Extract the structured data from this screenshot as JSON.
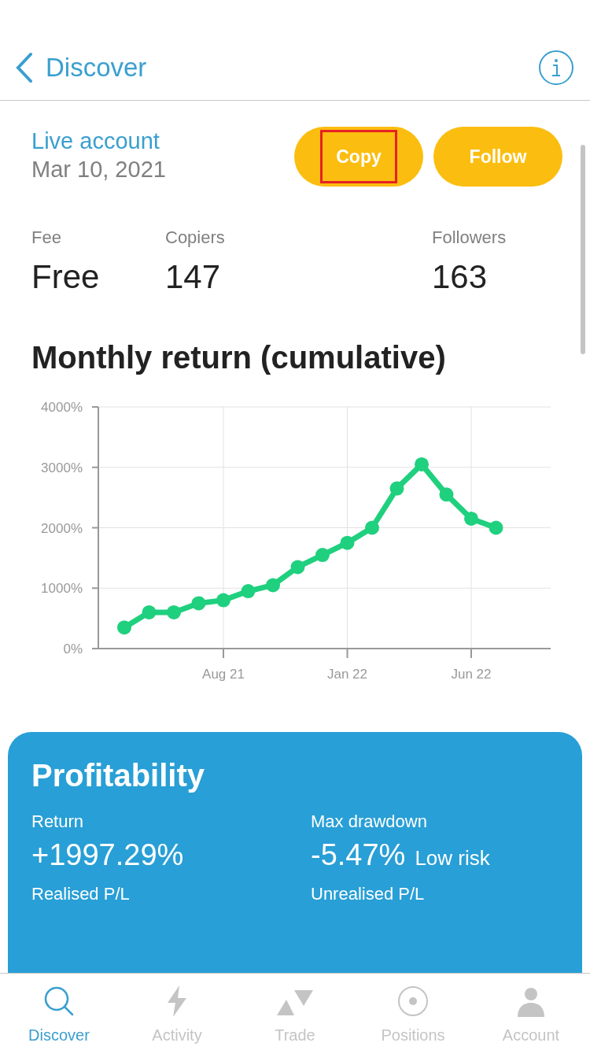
{
  "header": {
    "back_label": "Discover"
  },
  "account": {
    "type": "Live account",
    "date": "Mar 10, 2021"
  },
  "buttons": [
    {
      "label": "Copy",
      "highlighted": true
    },
    {
      "label": "Follow",
      "highlighted": false
    }
  ],
  "stats": [
    {
      "label": "Fee",
      "value": "Free"
    },
    {
      "label": "Copiers",
      "value": "147"
    },
    {
      "label": "Followers",
      "value": "163"
    }
  ],
  "chart_section": {
    "title": "Monthly return (cumulative)",
    "chart_data": {
      "type": "line",
      "categories": [
        null,
        null,
        null,
        null,
        "Aug 21",
        null,
        null,
        null,
        null,
        "Jan 22",
        null,
        null,
        null,
        null,
        "Jun 22",
        null
      ],
      "grid": true,
      "series": [
        {
          "color": "#1fd07e",
          "marker": "circle",
          "values": [
            350,
            600,
            600,
            750,
            800,
            950,
            1050,
            1350,
            1550,
            1750,
            2000,
            2650,
            3050,
            2550,
            2150,
            2000
          ]
        }
      ],
      "ylim": [
        0,
        4000
      ],
      "yticks": [
        {
          "value": 0,
          "label": "0%"
        },
        {
          "value": 1000,
          "label": "1000%"
        },
        {
          "value": 2000,
          "label": "2000%"
        },
        {
          "value": 3000,
          "label": "3000%"
        },
        {
          "value": 4000,
          "label": "4000%"
        }
      ]
    }
  },
  "profitability": {
    "title": "Profitability",
    "metrics": [
      {
        "label": "Return",
        "value": "+1997.29%"
      },
      {
        "label": "Max drawdown",
        "value": "-5.47%",
        "note": "Low risk"
      },
      {
        "label": "Realised P/L"
      },
      {
        "label": "Unrealised P/L"
      }
    ]
  },
  "tab_bar": [
    {
      "label": "Discover",
      "kind": "search",
      "selected": true
    },
    {
      "label": "Activity",
      "kind": "bolt",
      "selected": false
    },
    {
      "label": "Trade",
      "kind": "trade",
      "selected": false
    },
    {
      "label": "Positions",
      "kind": "target",
      "selected": false
    },
    {
      "label": "Account",
      "kind": "person",
      "selected": false
    }
  ]
}
